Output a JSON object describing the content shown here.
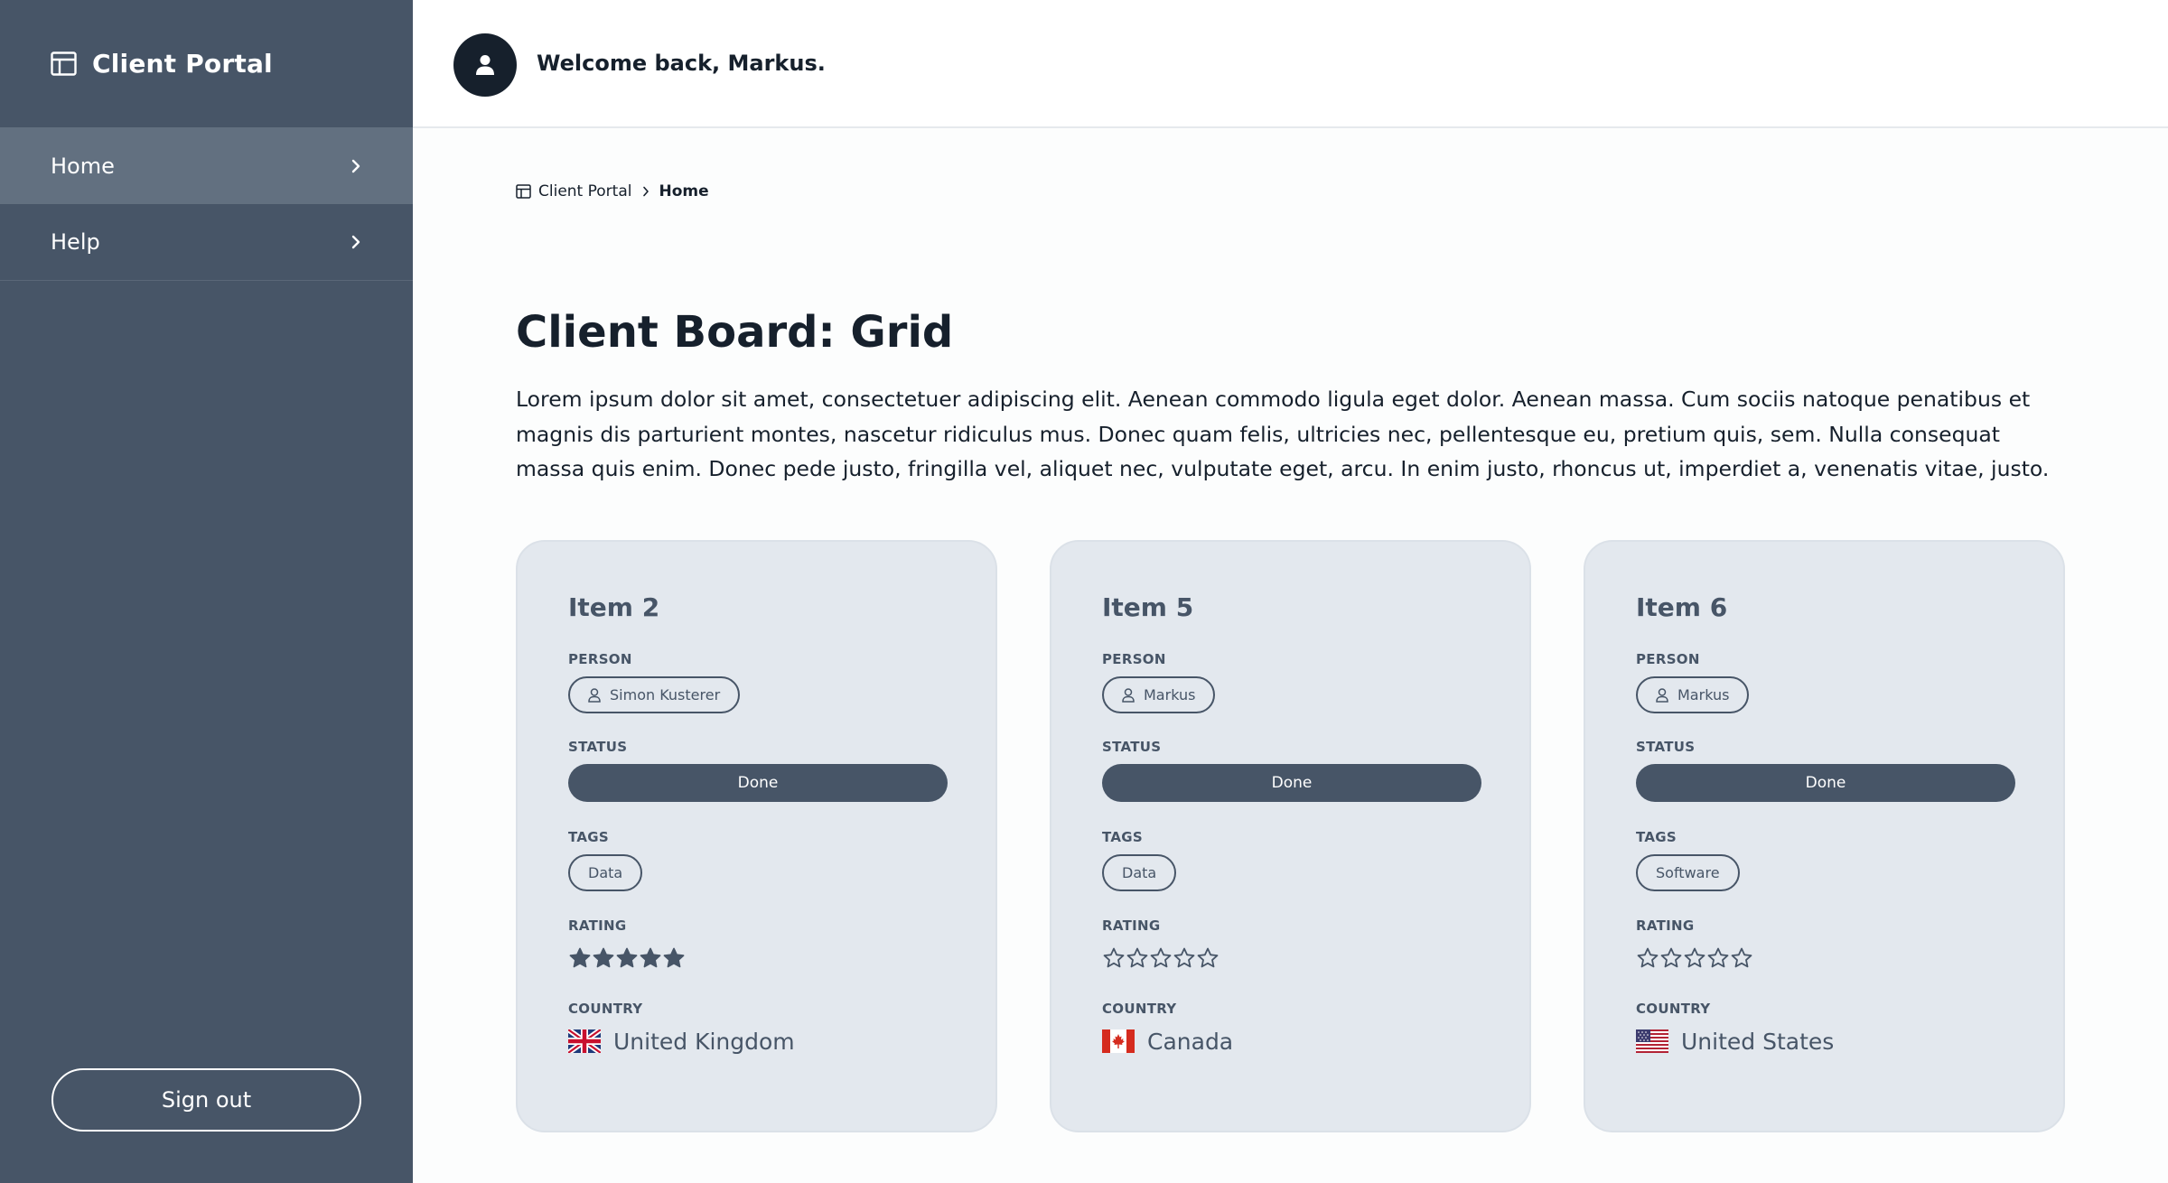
{
  "sidebar": {
    "brand": "Client Portal",
    "items": [
      {
        "label": "Home",
        "active": true
      },
      {
        "label": "Help",
        "active": false
      }
    ],
    "signout_label": "Sign out"
  },
  "header": {
    "welcome": "Welcome back, Markus."
  },
  "breadcrumb": {
    "root": "Client Portal",
    "current": "Home"
  },
  "page": {
    "title": "Client Board: Grid",
    "intro": "Lorem ipsum dolor sit amet, consectetuer adipiscing elit. Aenean commodo ligula eget dolor. Aenean massa. Cum sociis natoque penatibus et magnis dis parturient montes, nascetur ridiculus mus. Donec quam felis, ultricies nec, pellentesque eu, pretium quis, sem. Nulla consequat massa quis enim. Donec pede justo, fringilla vel, aliquet nec, vulputate eget, arcu. In enim justo, rhoncus ut, imperdiet a, venenatis vitae, justo."
  },
  "labels": {
    "person": "PERSON",
    "status": "STATUS",
    "tags": "TAGS",
    "rating": "RATING",
    "country": "COUNTRY"
  },
  "cards": [
    {
      "title": "Item 2",
      "person": "Simon Kusterer",
      "status": "Done",
      "tag": "Data",
      "rating": 5,
      "rating_max": 5,
      "country": "United Kingdom",
      "flag": "uk-flag-icon"
    },
    {
      "title": "Item 5",
      "person": "Markus",
      "status": "Done",
      "tag": "Data",
      "rating": 0,
      "rating_max": 5,
      "country": "Canada",
      "flag": "canada-flag-icon"
    },
    {
      "title": "Item 6",
      "person": "Markus",
      "status": "Done",
      "tag": "Software",
      "rating": 0,
      "rating_max": 5,
      "country": "United States",
      "flag": "us-flag-icon"
    }
  ],
  "colors": {
    "sidebar_bg": "#475567",
    "nav_active_bg": "#627080",
    "card_bg": "#e3e8ee",
    "accent": "#475567",
    "heading": "#16202c"
  }
}
